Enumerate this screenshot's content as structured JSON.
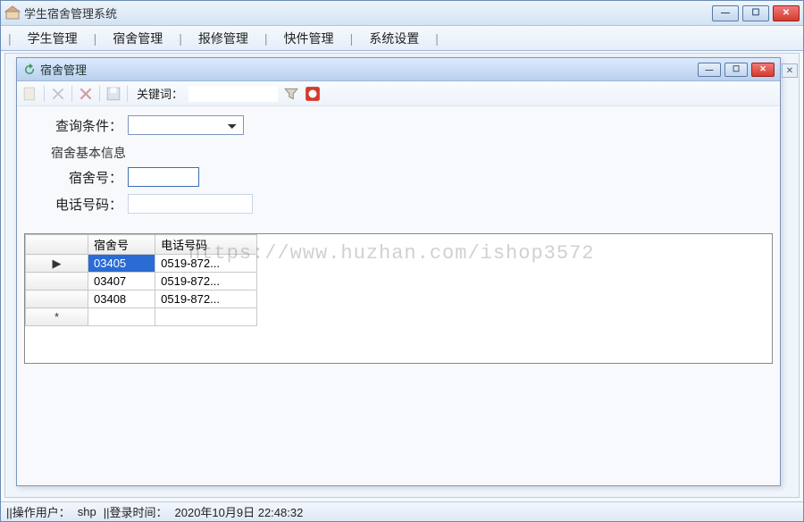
{
  "mainWindow": {
    "title": "学生宿舍管理系统"
  },
  "menubar": {
    "items": [
      "学生管理",
      "宿舍管理",
      "报修管理",
      "快件管理",
      "系统设置"
    ]
  },
  "childWindow": {
    "title": "宿舍管理"
  },
  "toolbar": {
    "keywordLabel": "关键词："
  },
  "form": {
    "queryLabel": "查询条件：",
    "querySelected": "",
    "basicInfoLabel": "宿舍基本信息",
    "dormLabel": "宿舍号：",
    "dormValue": "",
    "phoneLabel": "电话号码：",
    "phoneValue": ""
  },
  "grid": {
    "headers": [
      "宿舍号",
      "电话号码"
    ],
    "rows": [
      {
        "marker": "▶",
        "dorm": "03405",
        "phone": "0519-872...",
        "selected": true
      },
      {
        "marker": "",
        "dorm": "03407",
        "phone": "0519-872...",
        "selected": false
      },
      {
        "marker": "",
        "dorm": "03408",
        "phone": "0519-872...",
        "selected": false
      }
    ],
    "newRowMarker": "*"
  },
  "watermark": "https://www.huzhan.com/ishop3572",
  "statusbar": {
    "userLabel": "||操作用户：",
    "userValue": "shp",
    "loginLabel": "||登录时间：",
    "loginValue": "2020年10月9日 22:48:32"
  }
}
